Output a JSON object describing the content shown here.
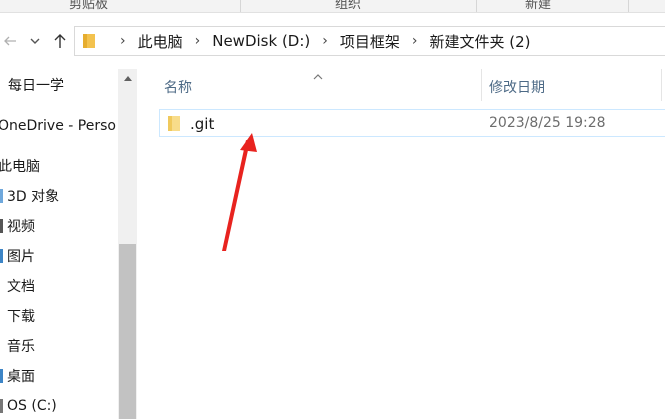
{
  "ribbon": {
    "groups": [
      "剪贴板",
      "组织",
      "新建"
    ]
  },
  "toolbar": {
    "back_icon": "back-arrow-icon",
    "recent_icon": "chevron-down-icon",
    "up_icon": "up-arrow-icon"
  },
  "address_bar": {
    "crumbs": [
      "此电脑",
      "NewDisk (D:)",
      "项目框架",
      "新建文件夹 (2)"
    ]
  },
  "nav_pane": {
    "items": [
      {
        "label": "每日一学",
        "icon": "folder-icon"
      },
      {
        "label": "OneDrive - Perso",
        "icon": "cloud-icon"
      },
      {
        "label": "此电脑",
        "icon": "computer-icon"
      },
      {
        "label": "3D 对象",
        "icon": "cube-icon"
      },
      {
        "label": "视频",
        "icon": "video-icon"
      },
      {
        "label": "图片",
        "icon": "picture-icon"
      },
      {
        "label": "文档",
        "icon": "document-icon"
      },
      {
        "label": "下载",
        "icon": "download-icon"
      },
      {
        "label": "音乐",
        "icon": "music-icon"
      },
      {
        "label": "桌面",
        "icon": "desktop-icon"
      },
      {
        "label": "OS (C:)",
        "icon": "drive-icon"
      }
    ]
  },
  "file_list": {
    "columns": {
      "name": "名称",
      "modified": "修改日期"
    },
    "rows": [
      {
        "name": ".git",
        "modified": "2023/8/25 19:28",
        "icon": "folder-icon"
      }
    ]
  },
  "annotation": {
    "color": "#e8231f",
    "type": "red-arrow"
  },
  "colors": {
    "header_text": "#4d6a86",
    "selection_border": "#cce8ff",
    "folder": "#f3c24e"
  }
}
